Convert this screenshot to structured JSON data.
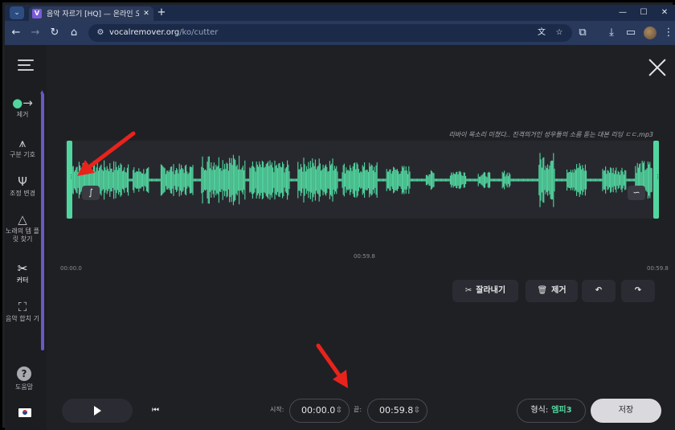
{
  "browser": {
    "tab_title": "음악 자르기 [HQ] — 온라인 오",
    "tab_favicon": "V",
    "url_host": "vocalremover.org",
    "url_path": "/ko/cutter"
  },
  "sidebar": {
    "items": [
      {
        "label": "제거",
        "icon": "dots-arrow-icon"
      },
      {
        "label": "구분 기호",
        "icon": "splitter-icon"
      },
      {
        "label": "조정 변경",
        "icon": "tuning-fork-icon"
      },
      {
        "label": "노래의 템 플릿 찾기",
        "icon": "metronome-icon"
      },
      {
        "label": "커터",
        "icon": "scissors-icon"
      },
      {
        "label": "음악 합치 기",
        "icon": "joiner-icon"
      }
    ],
    "help_label": "도움말"
  },
  "editor": {
    "file_name": "리바이 목소리 미쳤다.. 진격의거인 성우들의 소름 돋는 대본 리딩 ㄷㄷ.mp3",
    "start_time_label": "00:00.0",
    "end_time_label": "00:59.8",
    "playhead_label": "00:59.8"
  },
  "actions": {
    "cut_label": "잘라내기",
    "remove_label": "제거"
  },
  "bottom": {
    "start_label": "시작:",
    "start_value": "00:00.0",
    "end_label": "끝:",
    "end_value": "00:59.8",
    "format_label": "형식:",
    "format_value": "엠피3",
    "save_label": "저장"
  },
  "colors": {
    "waveform": "#52d6a0",
    "accent_sidebar": "#6a58c6",
    "annotation_arrow": "#e8231c"
  }
}
